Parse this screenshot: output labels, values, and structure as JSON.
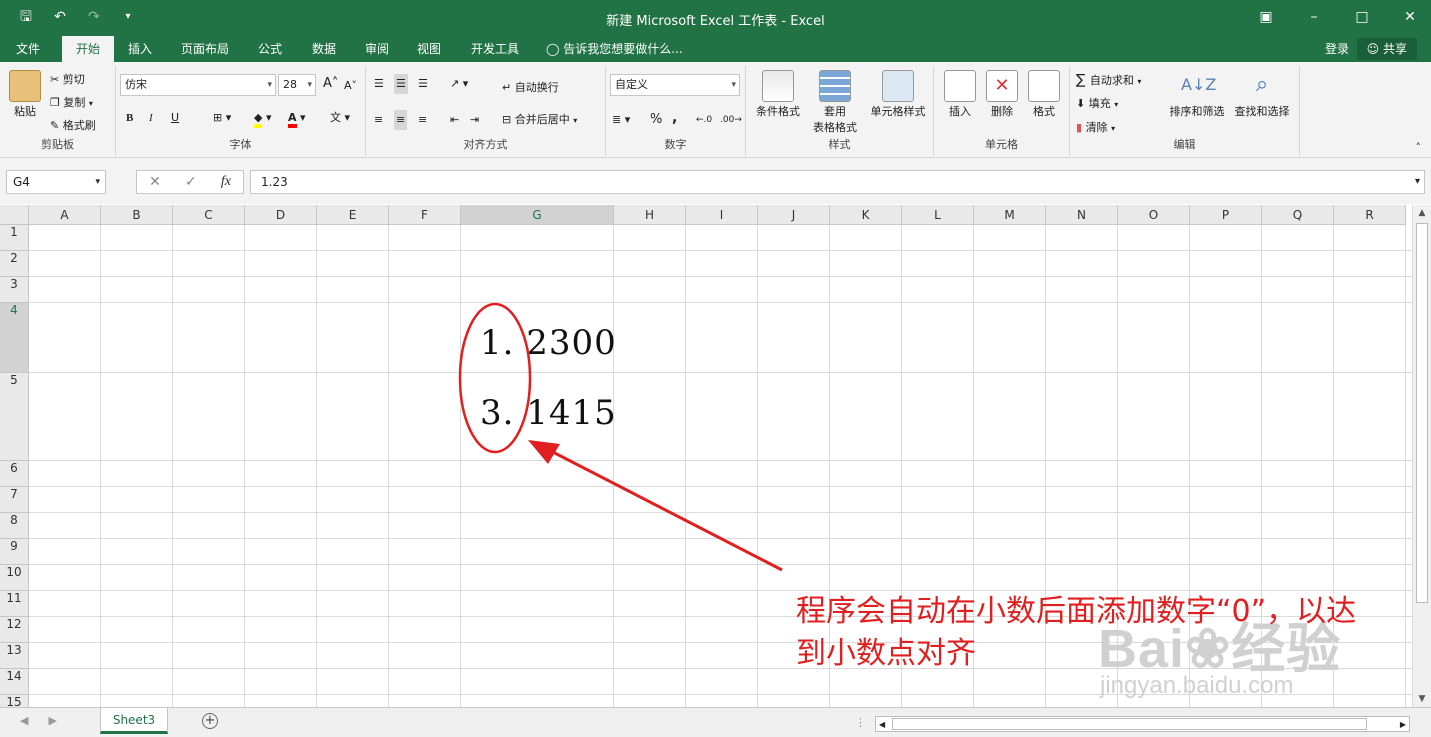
{
  "window": {
    "title": "新建 Microsoft Excel 工作表 - Excel"
  },
  "tabs": [
    {
      "label": "文件",
      "active": false
    },
    {
      "label": "开始",
      "active": true
    },
    {
      "label": "插入",
      "active": false
    },
    {
      "label": "页面布局",
      "active": false
    },
    {
      "label": "公式",
      "active": false
    },
    {
      "label": "数据",
      "active": false
    },
    {
      "label": "审阅",
      "active": false
    },
    {
      "label": "视图",
      "active": false
    },
    {
      "label": "开发工具",
      "active": false
    }
  ],
  "tell_me": "告诉我您想要做什么...",
  "login_label": "登录",
  "share_label": "共享",
  "ribbon": {
    "clipboard": {
      "paste": "粘贴",
      "cut": "剪切",
      "copy": "复制",
      "format_painter": "格式刷",
      "label": "剪贴板"
    },
    "font": {
      "name": "仿宋",
      "size": "28",
      "label": "字体",
      "bold": "B",
      "italic": "I",
      "underline": "U"
    },
    "alignment": {
      "wrap": "自动换行",
      "merge": "合并后居中",
      "label": "对齐方式"
    },
    "number": {
      "format": "自定义",
      "percent": "%",
      "comma": ",",
      "label": "数字"
    },
    "styles": {
      "conditional": "条件格式",
      "table_l1": "套用",
      "table_l2": "表格格式",
      "cell_styles": "单元格样式",
      "label": "样式"
    },
    "cells": {
      "insert": "插入",
      "delete": "删除",
      "format": "格式",
      "label": "单元格"
    },
    "editing": {
      "autosum": "自动求和",
      "fill": "填充",
      "clear": "清除",
      "sort": "排序和筛选",
      "find": "查找和选择",
      "label": "编辑"
    }
  },
  "formula_bar": {
    "name_box": "G4",
    "fx": "fx",
    "value": "1.23"
  },
  "columns": [
    "A",
    "B",
    "C",
    "D",
    "E",
    "F",
    "G",
    "H",
    "I",
    "J",
    "K",
    "L",
    "M",
    "N",
    "O",
    "P",
    "Q",
    "R"
  ],
  "rows": [
    "1",
    "2",
    "3",
    "4",
    "5",
    "6",
    "7",
    "8",
    "9",
    "10",
    "11",
    "12",
    "13",
    "14",
    "15"
  ],
  "cells": {
    "G4": "1. 2300",
    "G5": "3. 1415"
  },
  "sheets": [
    "Sheet3"
  ],
  "annotation": {
    "line1": "程序会自动在小数后面添加数字“0”，以达",
    "line2": "到小数点对齐"
  },
  "watermark": {
    "logo": "Bai",
    "logo_cn": "经验",
    "url": "jingyan.baidu.com"
  },
  "colors": {
    "excel_green": "#217346",
    "annotation_red": "#e02020"
  }
}
